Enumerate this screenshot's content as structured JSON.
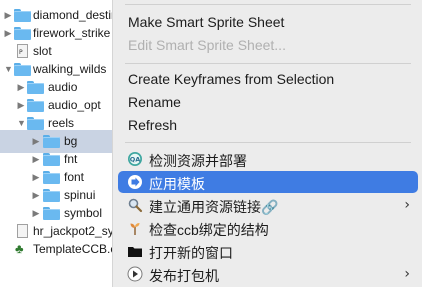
{
  "tree": {
    "items": [
      {
        "label": "diamond_destin",
        "type": "folder",
        "expanded": false
      },
      {
        "label": "firework_strike",
        "type": "folder",
        "expanded": false
      },
      {
        "label": "slot",
        "type": "file"
      },
      {
        "label": "walking_wilds",
        "type": "folder",
        "expanded": true
      },
      {
        "label": "audio",
        "type": "folder",
        "expanded": false
      },
      {
        "label": "audio_opt",
        "type": "folder",
        "expanded": false
      },
      {
        "label": "reels",
        "type": "folder",
        "expanded": true
      },
      {
        "label": "bg",
        "type": "folder",
        "expanded": false,
        "selected": true
      },
      {
        "label": "fnt",
        "type": "folder",
        "expanded": false
      },
      {
        "label": "font",
        "type": "folder",
        "expanded": false
      },
      {
        "label": "spinui",
        "type": "folder",
        "expanded": false
      },
      {
        "label": "symbol",
        "type": "folder",
        "expanded": false
      },
      {
        "label": "hr_jackpot2_sy",
        "type": "file"
      },
      {
        "label": "TemplateCCB.c",
        "type": "ccb"
      }
    ],
    "file_badge": "P"
  },
  "menu": {
    "items": [
      {
        "label": "Make Smart Sprite Sheet",
        "enabled": true
      },
      {
        "label": "Edit Smart Sprite Sheet...",
        "enabled": false
      },
      {
        "label": "Create Keyframes from Selection",
        "enabled": true
      },
      {
        "label": "Rename",
        "enabled": true
      },
      {
        "label": "Refresh",
        "enabled": true
      },
      {
        "label": "检测资源并部署",
        "icon": "qa-badge-icon"
      },
      {
        "label": "应用模板",
        "icon": "template-arrow-icon",
        "highlighted": true
      },
      {
        "label": "建立通用资源链接🔗",
        "icon": "magnifier-icon",
        "submenu": true
      },
      {
        "label": "检查ccb绑定的结构",
        "icon": "sprout-icon"
      },
      {
        "label": "打开新的窗口",
        "icon": "folder-black-icon"
      },
      {
        "label": "发布打包机",
        "icon": "publish-icon",
        "submenu": true
      }
    ],
    "qa_text": "QA",
    "submenu_glyph": "›"
  },
  "colors": {
    "highlight": "#3f7ce3",
    "selected_row": "#c9d3e3",
    "folder": "#6ab9f0",
    "menu_bg": "#ececec"
  }
}
